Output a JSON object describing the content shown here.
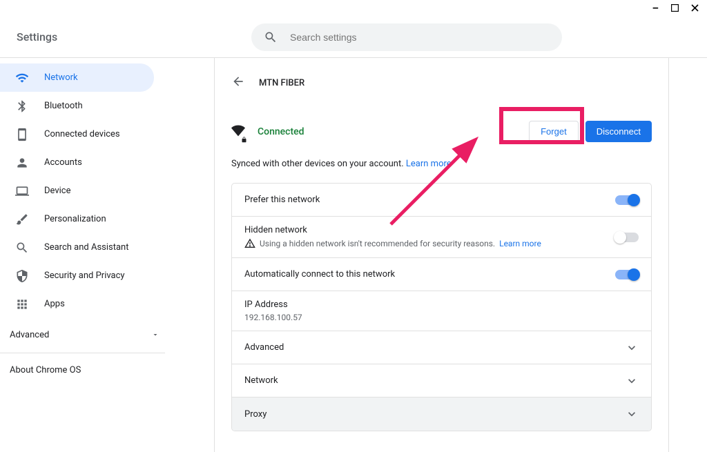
{
  "title_bar": {
    "minimize": "—",
    "maximize": "▢",
    "close": "✕"
  },
  "header": {
    "title": "Settings",
    "search_placeholder": "Search settings"
  },
  "sidebar": {
    "items": [
      {
        "label": "Network",
        "icon": "wifi"
      },
      {
        "label": "Bluetooth",
        "icon": "bluetooth"
      },
      {
        "label": "Connected devices",
        "icon": "device"
      },
      {
        "label": "Accounts",
        "icon": "person"
      },
      {
        "label": "Device",
        "icon": "laptop"
      },
      {
        "label": "Personalization",
        "icon": "brush"
      },
      {
        "label": "Search and Assistant",
        "icon": "search"
      },
      {
        "label": "Security and Privacy",
        "icon": "shield"
      },
      {
        "label": "Apps",
        "icon": "apps"
      }
    ],
    "advanced": "Advanced",
    "about": "About Chrome OS"
  },
  "main": {
    "page_title": "MTN FIBER",
    "status": "Connected",
    "forget_label": "Forget",
    "disconnect_label": "Disconnect",
    "sync_text": "Synced with other devices on your account. ",
    "learn_more": "Learn more",
    "rows": {
      "prefer": "Prefer this network",
      "hidden_title": "Hidden network",
      "hidden_sub": "Using a hidden network isn't recommended for security reasons.  ",
      "auto": "Automatically connect to this network",
      "ip_title": "IP Address",
      "ip_value": "192.168.100.57",
      "advanced": "Advanced",
      "network": "Network",
      "proxy": "Proxy"
    }
  }
}
